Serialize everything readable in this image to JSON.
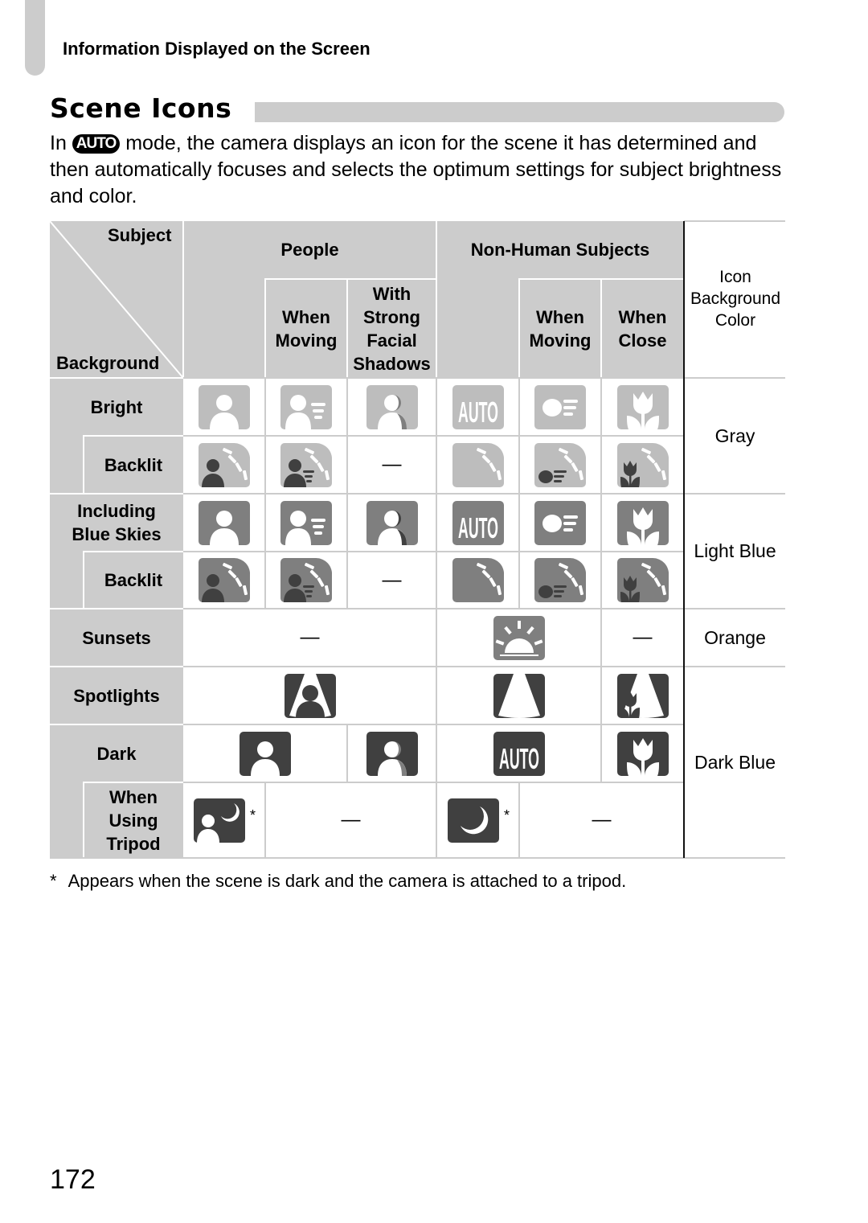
{
  "header": {
    "section_title": "Information Displayed on the Screen",
    "page_title": "Scene Icons"
  },
  "intro": {
    "before": "In ",
    "mode_badge": "AUTO",
    "after": " mode, the camera displays an icon for the scene it has determined and then automatically focuses and selects the optimum settings for subject brightness and color."
  },
  "table": {
    "corner": {
      "subject": "Subject",
      "background": "Background"
    },
    "group_headers": {
      "people": "People",
      "non_human": "Non-Human Subjects",
      "icon_bg_color": "Icon Background Color"
    },
    "sub_headers": {
      "people_moving": "When Moving",
      "people_shadows": "With Strong Facial Shadows",
      "nonhuman_moving": "When Moving",
      "nonhuman_close": "When Close"
    },
    "rows": {
      "bright": "Bright",
      "bright_backlit": "Backlit",
      "blue_skies": "Including Blue Skies",
      "blue_backlit": "Backlit",
      "sunsets": "Sunsets",
      "spotlights": "Spotlights",
      "dark": "Dark",
      "tripod": "When Using Tripod"
    },
    "colors": {
      "gray": "Gray",
      "light_blue": "Light Blue",
      "orange": "Orange",
      "dark_blue": "Dark Blue"
    },
    "dash": "—",
    "asterisk": "*",
    "icon_shades": {
      "gray": "#bdbdbd",
      "light_blue": "#7f7f7f",
      "orange": "#7f7f7f",
      "dark_blue": "#404040",
      "silhouette": "#404040"
    }
  },
  "footnote": {
    "mark": "*",
    "text": "Appears when the scene is dark and the camera is attached to a tripod."
  },
  "page_number": "172"
}
